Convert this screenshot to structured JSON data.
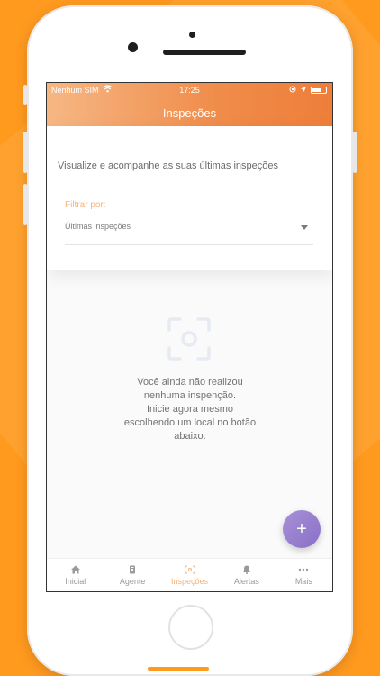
{
  "status_bar": {
    "carrier": "Nenhum SIM",
    "time": "17:25"
  },
  "header": {
    "title": "Inspeções"
  },
  "card": {
    "subtitle": "Visualize e acompanhe as suas últimas inspeções",
    "filter_label": "Filtrar por:",
    "filter_value": "Últimas inspeções"
  },
  "empty_state": {
    "lines": [
      "Você ainda não realizou",
      "nenhuma inspenção.",
      "Inicie agora mesmo",
      "escolhendo um local no botão",
      "abaixo."
    ],
    "icon": "scan-icon"
  },
  "fab": {
    "label": "+"
  },
  "tabs": [
    {
      "label": "Inicial",
      "icon": "home-icon"
    },
    {
      "label": "Agente",
      "icon": "badge-icon"
    },
    {
      "label": "Inspeções",
      "icon": "scan-icon",
      "active": true
    },
    {
      "label": "Alertas",
      "icon": "bell-icon"
    },
    {
      "label": "Mais",
      "icon": "more-icon"
    }
  ],
  "colors": {
    "background": "#ff9a1f",
    "header_gradient_start": "#f6b784",
    "header_gradient_end": "#ee7e3a",
    "accent": "#f2b47e",
    "fab": "#9b82cf"
  }
}
